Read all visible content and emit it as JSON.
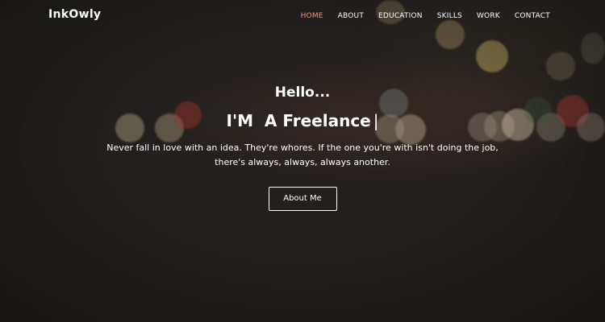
{
  "brand": "InkOwly",
  "nav": [
    {
      "label": "HOME",
      "active": true
    },
    {
      "label": "ABOUT",
      "active": false
    },
    {
      "label": "EDUCATION",
      "active": false
    },
    {
      "label": "SKILLS",
      "active": false
    },
    {
      "label": "WORK",
      "active": false
    },
    {
      "label": "CONTACT",
      "active": false
    }
  ],
  "hero": {
    "greeting": "Hello...",
    "headline": "I'M  A Freelance",
    "cursor": "|",
    "tagline": "Never fall in love with an idea. They're whores. If the one you're with isn't doing the job, there's always, always, always another.",
    "cta_label": "About Me"
  },
  "colors": {
    "background": "#221f1e",
    "accent": "#e8967f",
    "text": "#ffffff"
  }
}
